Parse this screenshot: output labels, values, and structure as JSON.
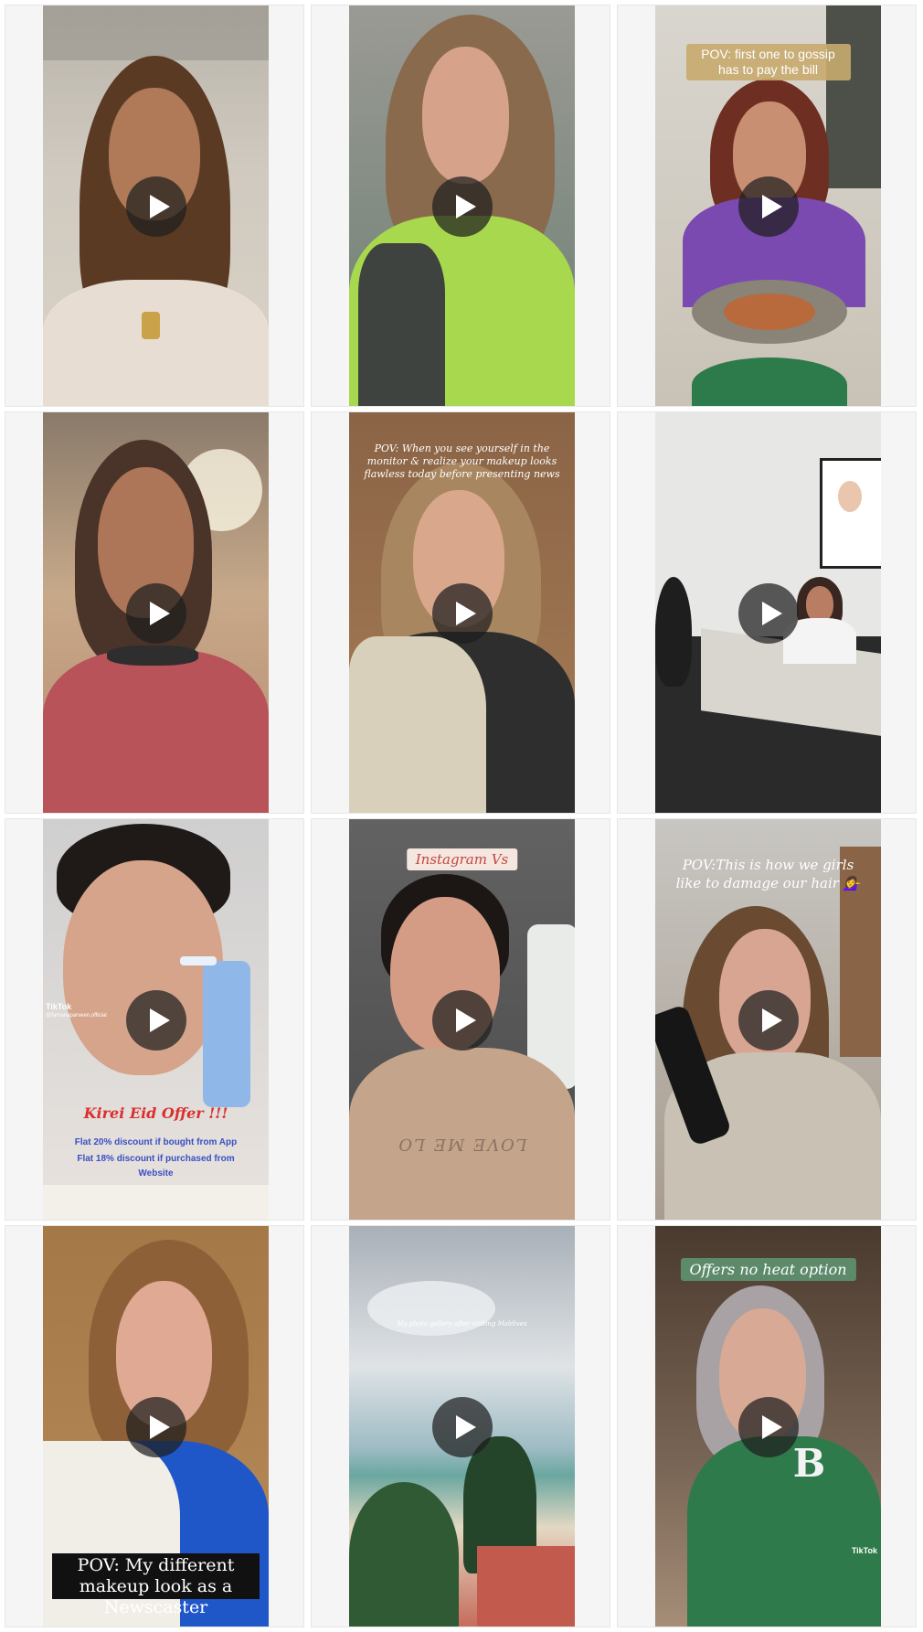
{
  "grid": {
    "videos": [
      {
        "id": "v1"
      },
      {
        "id": "v2"
      },
      {
        "id": "v3",
        "caption": "POV: first one to gossip has to pay the bill"
      },
      {
        "id": "v4"
      },
      {
        "id": "v5",
        "caption": "POV: When you see yourself in the monitor & realize your makeup looks flawless today before presenting news"
      },
      {
        "id": "v6"
      },
      {
        "id": "v7",
        "watermark_brand": "TikTok",
        "watermark_user": "@farhanaparveen.official",
        "offer_title": "Kirei Eid Offer !!!",
        "offer_line1": "Flat 20% discount if bought from App",
        "offer_line2": "Flat 18% discount if purchased from Website"
      },
      {
        "id": "v8",
        "caption": "Instagram Vs",
        "shirt_text": "LOVE ME LO"
      },
      {
        "id": "v9",
        "caption": "POV:This is how we girls like to damage our hair 💁‍♀️"
      },
      {
        "id": "v10",
        "caption": "POV: My different makeup look as a Newscaster"
      },
      {
        "id": "v11",
        "caption": "My photo gallery after visiting Maldives"
      },
      {
        "id": "v12",
        "caption": "Offers no heat option",
        "watermark_brand": "TikTok",
        "shirt_letter": "B"
      }
    ]
  },
  "colors": {
    "play_overlay": "#1e1e1e",
    "offer_red": "#d92f2f",
    "offer_blue": "#3a4fc4",
    "tag_green": "#5c8a6a"
  },
  "icons": {
    "play": "play-icon"
  }
}
